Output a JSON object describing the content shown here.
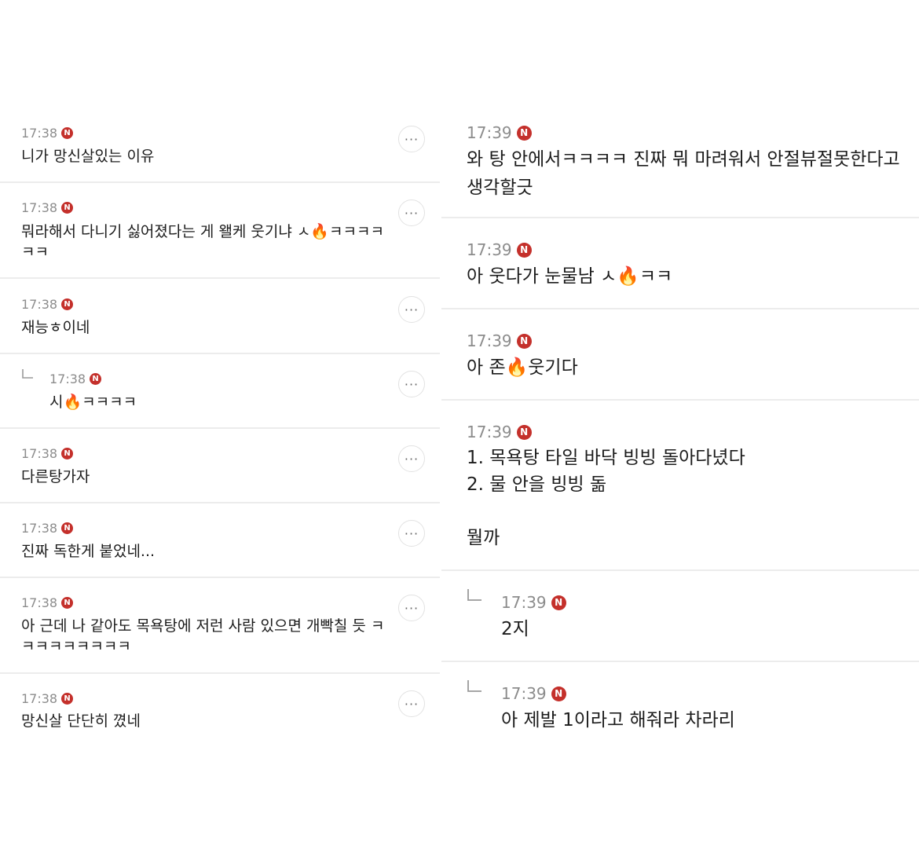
{
  "left_column": {
    "comments": [
      {
        "time": "17:38",
        "badge": "N",
        "text": "니가 망신살있는 이유",
        "more": "···",
        "is_reply": false
      },
      {
        "time": "17:38",
        "badge": "N",
        "text": "뭐라해서 다니기 싫어졌다는 게 왤케 웃기냐 ㅅ🔥ㅋㅋㅋㅋ\nㅋㅋ",
        "more": "···",
        "is_reply": false
      },
      {
        "time": "17:38",
        "badge": "N",
        "text": "재능ㅎ이네",
        "more": "···",
        "is_reply": false
      },
      {
        "time": "17:38",
        "badge": "N",
        "text": "시🔥ㅋㅋㅋㅋ",
        "more": "···",
        "is_reply": true
      },
      {
        "time": "17:38",
        "badge": "N",
        "text": "다른탕가자",
        "more": "···",
        "is_reply": false
      },
      {
        "time": "17:38",
        "badge": "N",
        "text": "진짜 독한게 붙었네...",
        "more": "···",
        "is_reply": false
      },
      {
        "time": "17:38",
        "badge": "N",
        "text": "아 근데 나 같아도 목욕탕에 저런 사람 있으면 개빡칠 듯 ㅋ\nㅋㅋㅋㅋㅋㅋㅋㅋ",
        "more": "···",
        "is_reply": false
      },
      {
        "time": "17:38",
        "badge": "N",
        "text": "망신살 단단히 꼈네",
        "more": "···",
        "is_reply": false
      }
    ]
  },
  "right_column": {
    "comments": [
      {
        "time": "17:39",
        "badge": "N",
        "text": "와 탕 안에서ㅋㅋㅋㅋ 진짜 뭐 마려워서 안절뷰절못한다고\n생각할긋",
        "is_reply": false
      },
      {
        "time": "17:39",
        "badge": "N",
        "text": "아 웃다가 눈물남 ㅅ🔥ㅋㅋ",
        "is_reply": false
      },
      {
        "time": "17:39",
        "badge": "N",
        "text": "아 존🔥웃기다",
        "is_reply": false
      },
      {
        "time": "17:39",
        "badge": "N",
        "text": "1. 목욕탕 타일 바닥 빙빙 돌아다녔다\n2. 물 안을 빙빙 돎\n\n뭘까",
        "is_reply": false
      },
      {
        "time": "17:39",
        "badge": "N",
        "text": "2지",
        "is_reply": true
      },
      {
        "time": "17:39",
        "badge": "N",
        "text": "아 제발 1이라고 해줘라 차라리",
        "is_reply": true
      }
    ]
  },
  "colors": {
    "badge": "#c4302b",
    "timestamp": "#8c8c8c",
    "separator": "#ececec",
    "text": "#1c1c1c"
  },
  "icons": {
    "badge": "n-badge-icon",
    "more": "more-options-icon",
    "reply": "reply-arrow-icon"
  }
}
